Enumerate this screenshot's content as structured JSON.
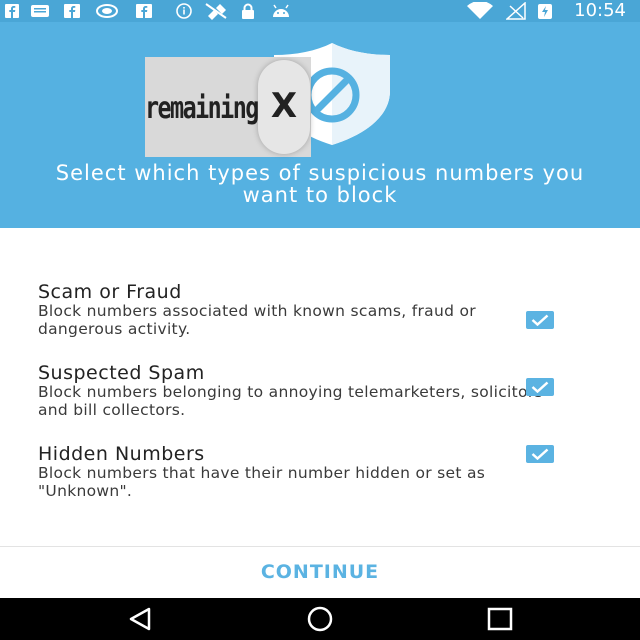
{
  "status_bar": {
    "time": "10:54",
    "left_icons": [
      "facebook-icon",
      "message-icon",
      "facebook-icon",
      "nvidia-icon",
      "facebook-icon",
      "info-icon",
      "satellite-icon",
      "lock-icon",
      "android-icon"
    ],
    "right_icons": [
      "wifi-icon",
      "no-signal-icon",
      "battery-charging-icon"
    ]
  },
  "header": {
    "title": "Select which types of suspicious numbers you want to block",
    "background_color": "#55b1e1",
    "icon": "shield-block-icon"
  },
  "ad_overlay": {
    "text": "remaining",
    "close_label": "X"
  },
  "options": [
    {
      "title": "Scam or Fraud",
      "description": "Block numbers associated with known scams, fraud or dangerous activity.",
      "checked": true
    },
    {
      "title": "Suspected Spam",
      "description": "Block numbers belonging to annoying telemarketers, solicitors and bill collectors.",
      "checked": true
    },
    {
      "title": "Hidden Numbers",
      "description": "Block numbers that have their number hidden or set as \"Unknown\".",
      "checked": true
    }
  ],
  "continue_label": "CONTINUE",
  "accent_color": "#5bb3e2",
  "nav_bar": {
    "buttons": [
      "back-icon",
      "home-icon",
      "recents-icon"
    ]
  }
}
